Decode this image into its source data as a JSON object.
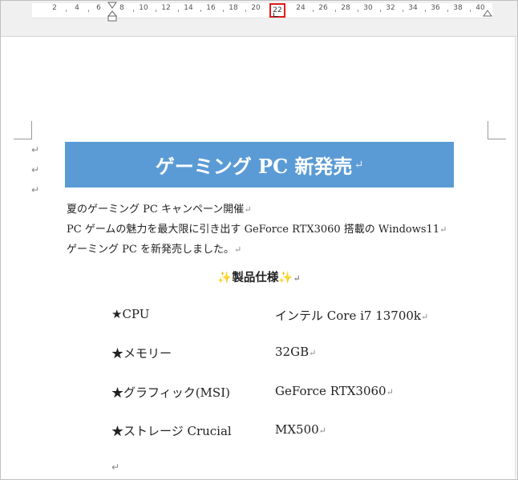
{
  "ruler": {
    "numbers": [
      "2",
      "4",
      "6",
      "8",
      "10",
      "12",
      "14",
      "16",
      "18",
      "20",
      "22",
      "24",
      "26",
      "28",
      "30",
      "32",
      "34",
      "36",
      "38",
      "40"
    ],
    "highlighted_tab": "22"
  },
  "document": {
    "title": "ゲーミング PC 新発売",
    "para_mark": "↵",
    "intro_lines": [
      "夏のゲーミング PC キャンペーン開催",
      "PC ゲームの魅力を最大限に引き出す GeForce RTX3060 搭載の Windows11",
      "ゲーミング PC を新発売しました。"
    ],
    "spec_heading": "製品仕様",
    "sparkle": "✨",
    "specs": [
      {
        "label": "★CPU",
        "value": "インテル Core i7 13700k"
      },
      {
        "label": "★メモリー",
        "value": "32GB"
      },
      {
        "label": "★グラフィック(MSI)",
        "value": "GeForce RTX3060"
      },
      {
        "label": "★ストレージ Crucial",
        "value": "MX500"
      }
    ]
  },
  "colors": {
    "title_background": "#5b9bd5",
    "tab_highlight": "#e01b1b"
  }
}
